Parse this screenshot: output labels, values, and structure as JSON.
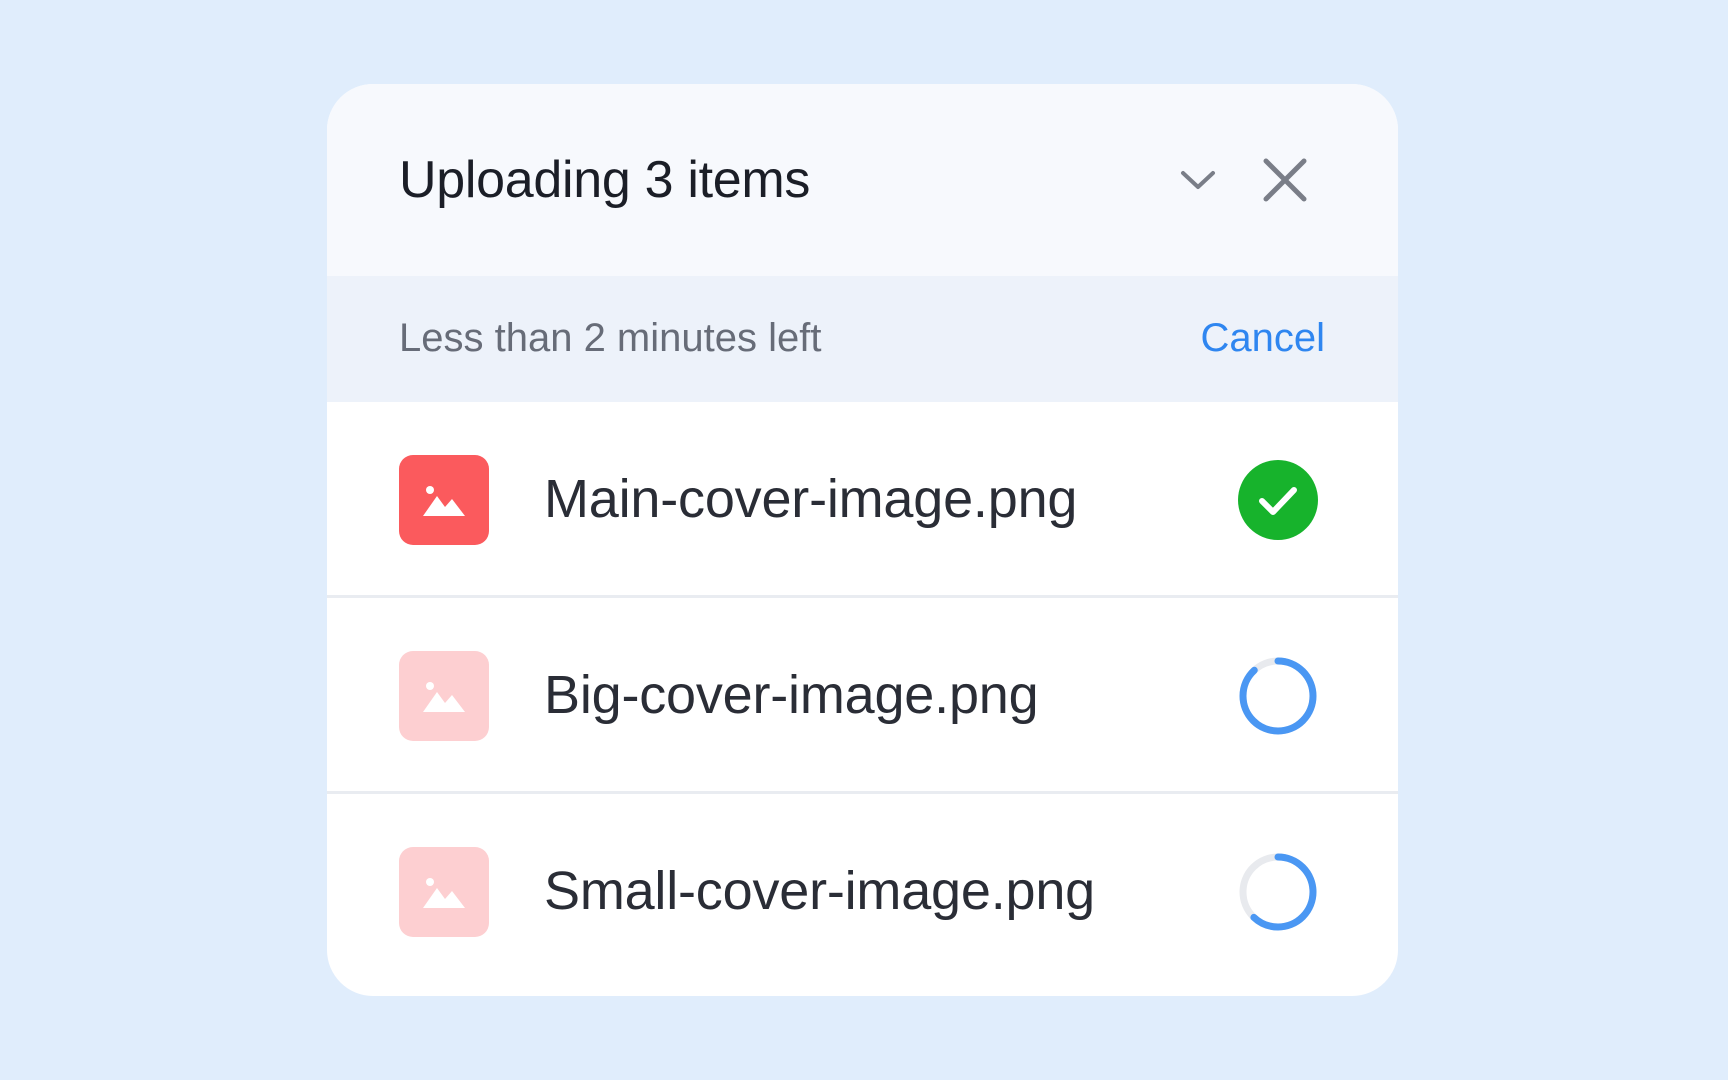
{
  "upload": {
    "title": "Uploading 3 items",
    "status_text": "Less than 2 minutes left",
    "cancel_label": "Cancel",
    "collapse_icon": "chevron-down-icon",
    "close_icon": "close-icon",
    "accent_color": "#2f86f0",
    "success_color": "#17b32c",
    "files": [
      {
        "name": "Main-cover-image.png",
        "status": "complete",
        "icon": "image-icon",
        "progress": 1.0
      },
      {
        "name": "Big-cover-image.png",
        "status": "uploading",
        "icon": "image-icon",
        "progress": 0.88
      },
      {
        "name": "Small-cover-image.png",
        "status": "uploading",
        "icon": "image-icon",
        "progress": 0.62
      }
    ]
  }
}
